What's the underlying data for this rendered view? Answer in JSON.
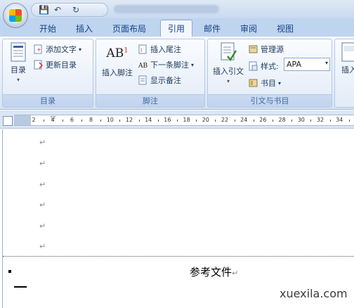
{
  "quick_access": {
    "save": "💾",
    "undo": "↶",
    "redo": "↻"
  },
  "tabs": [
    "开始",
    "插入",
    "页面布局",
    "引用",
    "邮件",
    "审阅",
    "视图"
  ],
  "active_tab": "引用",
  "toc_group": {
    "label": "目录",
    "toc_button": "目录",
    "add_text": "添加文字",
    "update_toc": "更新目录"
  },
  "footnote_group": {
    "label": "脚注",
    "insert_footnote": "插入脚注",
    "insert_endnote": "插入尾注",
    "next_footnote": "下一条脚注",
    "show_notes": "显示备注",
    "ab_icon_text": "AB",
    "ab_sup": "1"
  },
  "citation_group": {
    "label": "引文与书目",
    "insert_citation": "插入引文",
    "manage_sources": "管理源",
    "style_label": "样式:",
    "style_value": "APA",
    "bibliography": "书目"
  },
  "overflow_button": "插入",
  "ruler_numbers": [
    "2",
    "4",
    "6",
    "8",
    "10",
    "12",
    "14",
    "16",
    "18",
    "20",
    "22",
    "24",
    "26",
    "28",
    "30",
    "32",
    "34"
  ],
  "paragraph_mark": "↵",
  "document_heading": "参考文件",
  "watermark": "xuexila.com"
}
